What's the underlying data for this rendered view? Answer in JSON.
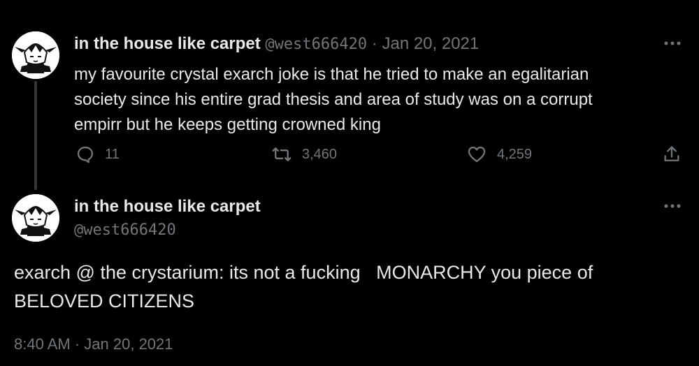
{
  "reply_tweet": {
    "display_name": "in the house like carpet",
    "handle": "@west666420",
    "separator": "·",
    "date": "Jan 20, 2021",
    "text_lines": [
      "my favourite crystal exarch joke is that he tried to make an egalitarian",
      "society since his entire grad thesis and area of study was on a corrupt",
      "empirr but he keeps getting crowned king"
    ],
    "actions": {
      "replies": "11",
      "retweets": "3,460",
      "likes": "4,259"
    }
  },
  "main_tweet": {
    "display_name": "in the house like carpet",
    "handle": "@west666420",
    "text_lines": [
      "exarch @ the crystarium: its not a fucking   MONARCHY you piece of",
      "BELOVED CITIZENS"
    ],
    "time": "8:40 AM",
    "separator": "·",
    "date": "Jan 20, 2021"
  },
  "icons": {
    "more": "more-horizontal-icon",
    "reply": "reply-bubble-icon",
    "retweet": "retweet-icon",
    "like": "heart-icon",
    "share": "share-upload-icon"
  },
  "colors": {
    "background": "#000000",
    "text": "#e7e9ea",
    "muted": "#71767b",
    "thread_line": "#333639"
  }
}
